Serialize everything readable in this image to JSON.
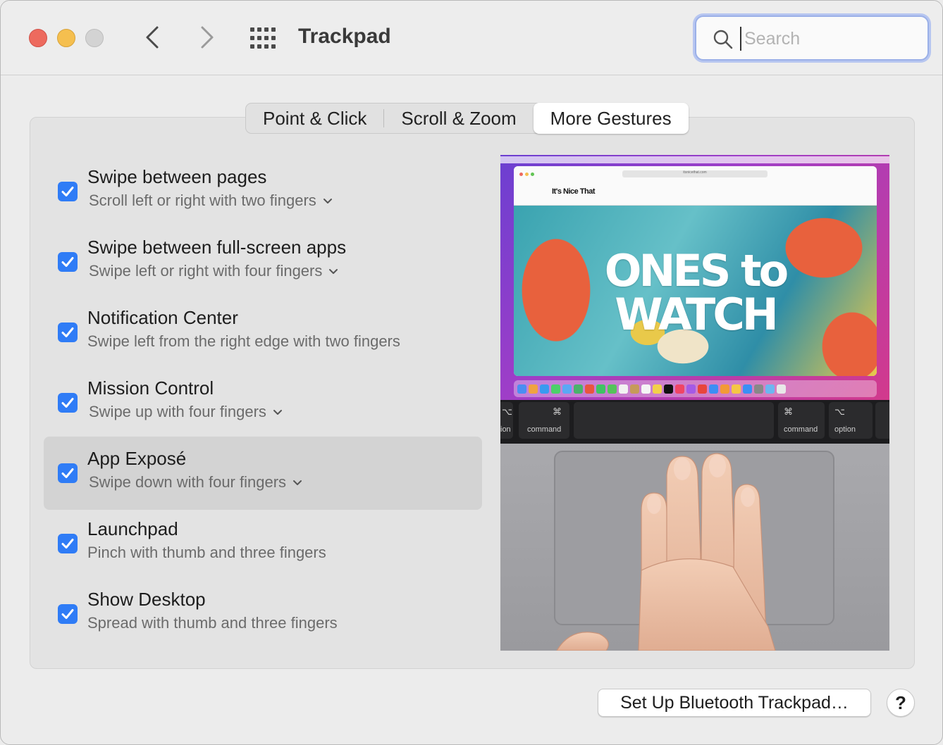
{
  "window": {
    "title": "Trackpad",
    "search_placeholder": "Search"
  },
  "tabs": [
    {
      "label": "Point & Click",
      "active": false
    },
    {
      "label": "Scroll & Zoom",
      "active": false
    },
    {
      "label": "More Gestures",
      "active": true
    }
  ],
  "gestures": [
    {
      "label": "Swipe between pages",
      "sub": "Scroll left or right with two fingers",
      "checked": true,
      "has_menu": true,
      "selected": false
    },
    {
      "label": "Swipe between full-screen apps",
      "sub": "Swipe left or right with four fingers",
      "checked": true,
      "has_menu": true,
      "selected": false
    },
    {
      "label": "Notification Center",
      "sub": "Swipe left from the right edge with two fingers",
      "checked": true,
      "has_menu": false,
      "selected": false
    },
    {
      "label": "Mission Control",
      "sub": "Swipe up with four fingers",
      "checked": true,
      "has_menu": true,
      "selected": false
    },
    {
      "label": "App Exposé",
      "sub": "Swipe down with four fingers",
      "checked": true,
      "has_menu": true,
      "selected": true
    },
    {
      "label": "Launchpad",
      "sub": "Pinch with thumb and three fingers",
      "checked": true,
      "has_menu": false,
      "selected": false
    },
    {
      "label": "Show Desktop",
      "sub": "Spread with thumb and three fingers",
      "checked": true,
      "has_menu": false,
      "selected": false
    }
  ],
  "preview": {
    "site_name": "It's Nice That",
    "url": "itsnicethat.com",
    "headline_line1": "ONES to",
    "headline_line2": "WATCH",
    "keys": [
      {
        "sym": "⌥",
        "label": "ion"
      },
      {
        "sym": "⌘",
        "label": "command"
      },
      {
        "sym": "⌘",
        "label": "command"
      },
      {
        "sym": "⌥",
        "label": "option"
      }
    ]
  },
  "footer": {
    "setup_button": "Set Up Bluetooth Trackpad…",
    "help_button": "?"
  },
  "colors": {
    "accent": "#2f7cf6",
    "close": "#ed6a5e",
    "minimize": "#f5bf4f",
    "zoom_disabled": "#d3d3d3"
  }
}
